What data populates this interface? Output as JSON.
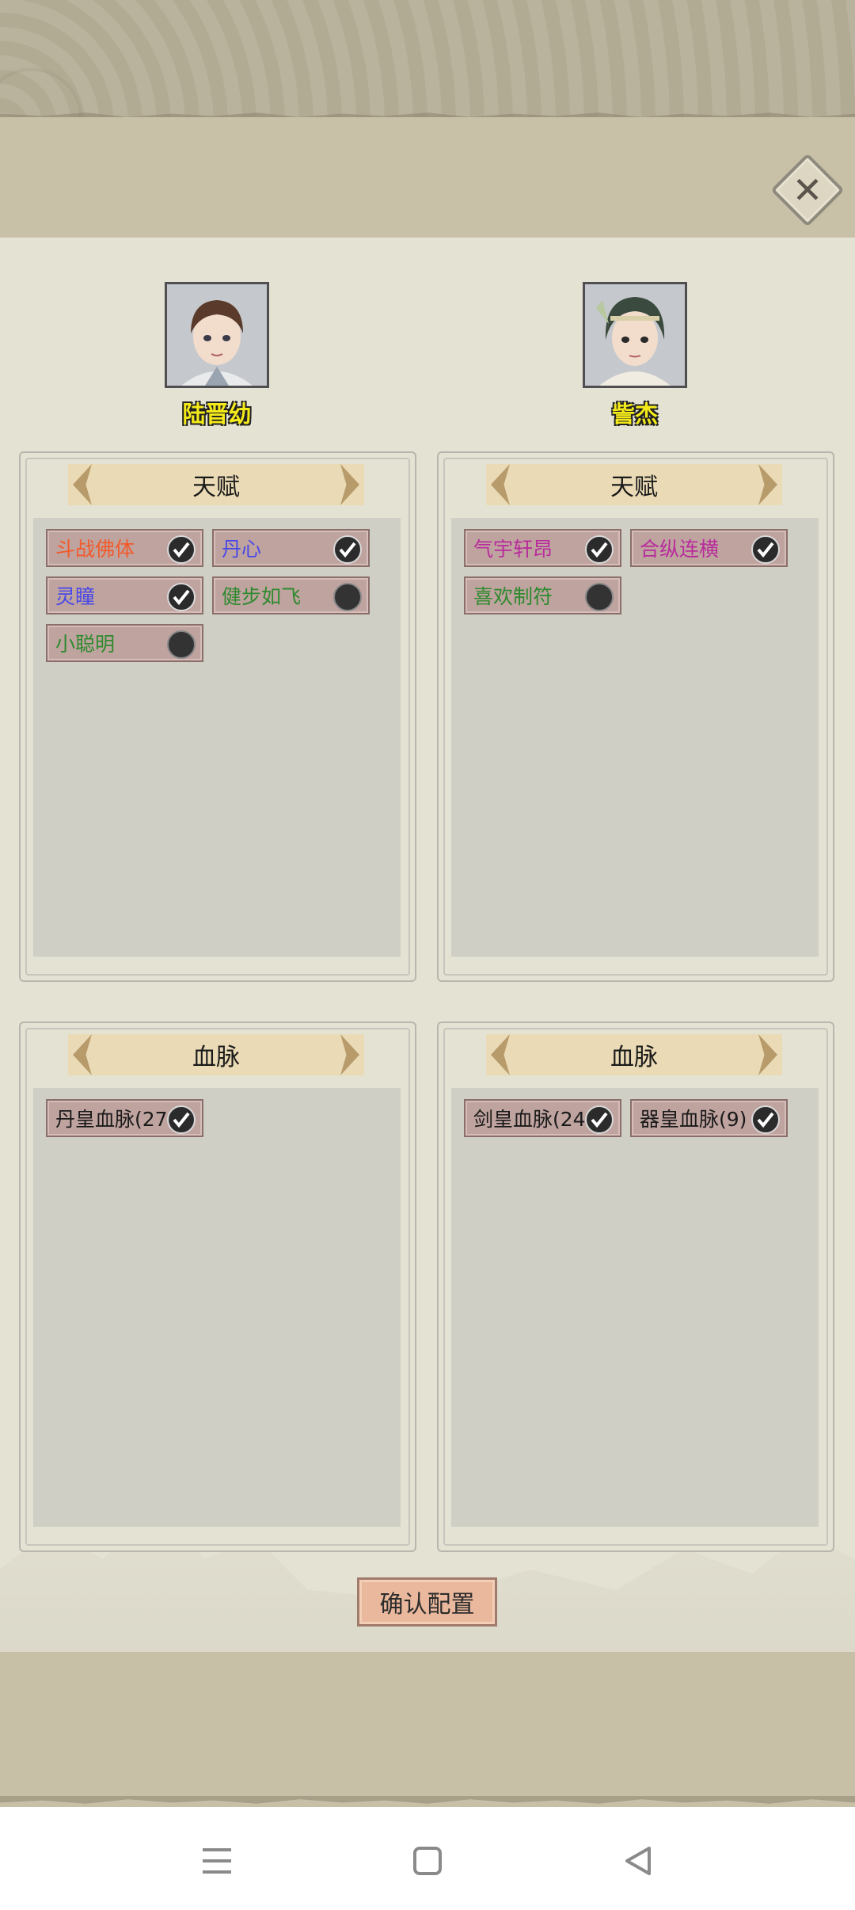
{
  "header": {
    "close_icon": "close-icon"
  },
  "characters": [
    {
      "name": "陆晋幼",
      "talent_title": "天赋",
      "talents": [
        {
          "label": "斗战佛体",
          "color": "#f25a2a",
          "checked": true
        },
        {
          "label": "丹心",
          "color": "#4848e8",
          "checked": true
        },
        {
          "label": "灵瞳",
          "color": "#4848e8",
          "checked": true
        },
        {
          "label": "健步如飞",
          "color": "#2e8a2e",
          "checked": false
        },
        {
          "label": "小聪明",
          "color": "#2e8a2e",
          "checked": false
        }
      ],
      "bloodline_title": "血脉",
      "bloodlines": [
        {
          "label": "丹皇血脉(27",
          "color": "#1a1a1a",
          "checked": true
        }
      ]
    },
    {
      "name": "訾杰",
      "talent_title": "天赋",
      "talents": [
        {
          "label": "气宇轩昂",
          "color": "#b82b9c",
          "checked": true
        },
        {
          "label": "合纵连横",
          "color": "#b82b9c",
          "checked": true
        },
        {
          "label": "喜欢制符",
          "color": "#2e8a2e",
          "checked": false
        }
      ],
      "bloodline_title": "血脉",
      "bloodlines": [
        {
          "label": "剑皇血脉(24",
          "color": "#1a1a1a",
          "checked": true
        },
        {
          "label": "器皇血脉(9)",
          "color": "#1a1a1a",
          "checked": true
        }
      ]
    }
  ],
  "confirm_label": "确认配置",
  "navbar": {
    "menu_icon": "menu-icon",
    "home_icon": "home-icon",
    "back_icon": "back-icon"
  }
}
